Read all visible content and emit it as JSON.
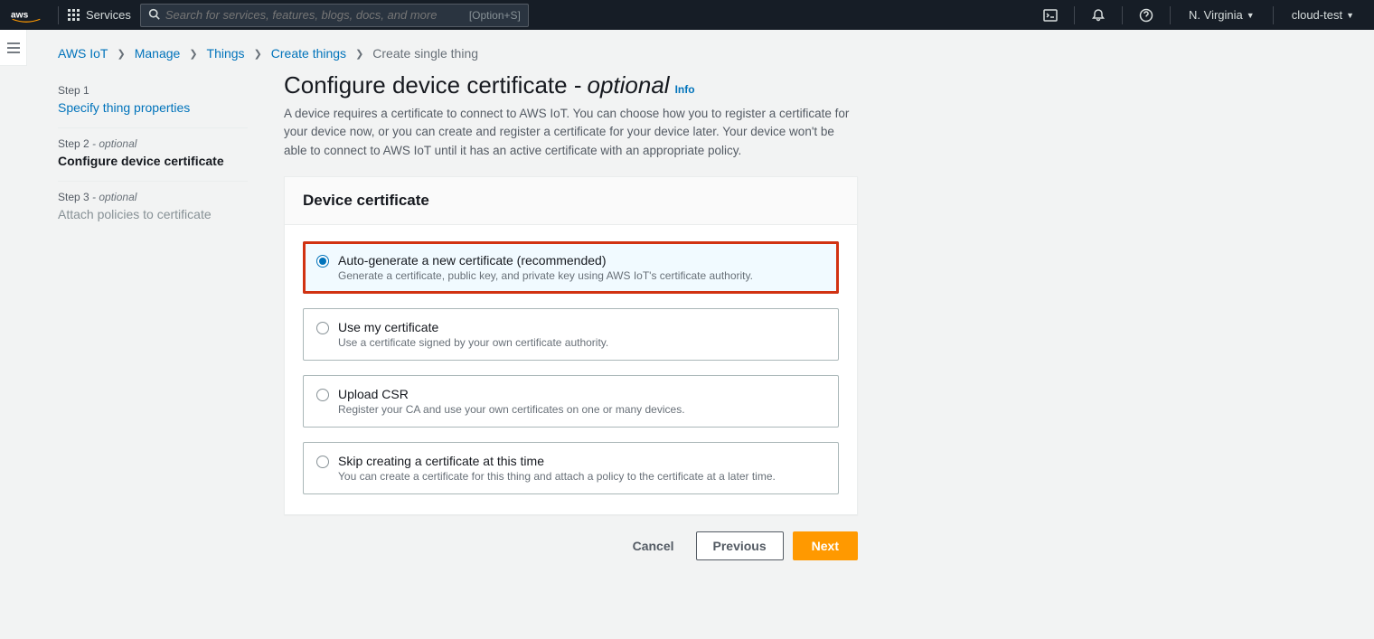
{
  "topnav": {
    "services_label": "Services",
    "search_placeholder": "Search for services, features, blogs, docs, and more",
    "search_shortcut": "[Option+S]",
    "region": "N. Virginia",
    "account": "cloud-test"
  },
  "breadcrumbs": {
    "items": [
      {
        "label": "AWS IoT",
        "link": true
      },
      {
        "label": "Manage",
        "link": true
      },
      {
        "label": "Things",
        "link": true
      },
      {
        "label": "Create things",
        "link": true
      },
      {
        "label": "Create single thing",
        "link": false
      }
    ]
  },
  "steps": {
    "s1": {
      "num": "Step 1",
      "label": "Specify thing properties"
    },
    "s2": {
      "num": "Step 2",
      "optional": "- optional",
      "label": "Configure device certificate"
    },
    "s3": {
      "num": "Step 3",
      "optional": "- optional",
      "label": "Attach policies to certificate"
    }
  },
  "heading": {
    "title": "Configure device certificate -",
    "suffix": "optional",
    "info": "Info",
    "desc": "A device requires a certificate to connect to AWS IoT. You can choose how you to register a certificate for your device now, or you can create and register a certificate for your device later. Your device won't be able to connect to AWS IoT until it has an active certificate with an appropriate policy."
  },
  "panel": {
    "header": "Device certificate",
    "options": {
      "o1": {
        "title": "Auto-generate a new certificate (recommended)",
        "desc": "Generate a certificate, public key, and private key using AWS IoT's certificate authority."
      },
      "o2": {
        "title": "Use my certificate",
        "desc": "Use a certificate signed by your own certificate authority."
      },
      "o3": {
        "title": "Upload CSR",
        "desc": "Register your CA and use your own certificates on one or many devices."
      },
      "o4": {
        "title": "Skip creating a certificate at this time",
        "desc": "You can create a certificate for this thing and attach a policy to the certificate at a later time."
      }
    }
  },
  "buttons": {
    "cancel": "Cancel",
    "previous": "Previous",
    "next": "Next"
  }
}
